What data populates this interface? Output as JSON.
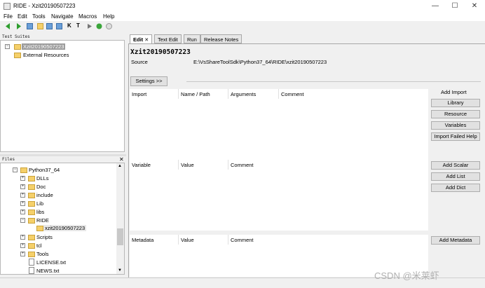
{
  "window": {
    "title": "RIDE - Xzit20190507223",
    "min": "—",
    "max": "☐",
    "close": "✕"
  },
  "menu": [
    "File",
    "Edit",
    "Tools",
    "Navigate",
    "Macros",
    "Help"
  ],
  "toolbar": {
    "icons": [
      "back-icon",
      "forward-icon",
      "open-folder-icon",
      "open-file-icon",
      "save-icon",
      "save-all-icon",
      "search-keyword-icon",
      "search-tests-icon",
      "run-icon",
      "debug-icon",
      "stop-icon"
    ]
  },
  "test_suites": {
    "header": "Test Suites",
    "items": [
      "Xzit20190507223",
      "External Resources"
    ]
  },
  "files": {
    "header": "Files",
    "close": "✕",
    "items": [
      "Python37_64",
      "DLLs",
      "Doc",
      "include",
      "Lib",
      "libs",
      "RIDE",
      "xzit20190507223",
      "Scripts",
      "tcl",
      "Tools",
      "LICENSE.txt",
      "NEWS.txt"
    ]
  },
  "tabs": [
    "Edit",
    "Text Edit",
    "Run",
    "Release Notes"
  ],
  "tab_close": "✕",
  "editor": {
    "suite_name": "Xzit20190507223",
    "source_label": "Source",
    "source_value": "E:\\VsShareToolSdk\\Python37_64\\RIDE\\xzit20190507223",
    "settings_button": "Settings >>",
    "import_table": {
      "headers": [
        "Import",
        "Name / Path",
        "Arguments",
        "Comment"
      ]
    },
    "import_buttons": {
      "title": "Add Import",
      "items": [
        "Library",
        "Resource",
        "Variables",
        "Import Failed Help"
      ]
    },
    "variable_table": {
      "headers": [
        "Variable",
        "Value",
        "Comment"
      ]
    },
    "variable_buttons": [
      "Add Scalar",
      "Add List",
      "Add Dict"
    ],
    "metadata_table": {
      "headers": [
        "Metadata",
        "Value",
        "Comment"
      ]
    },
    "metadata_button": "Add Metadata"
  },
  "watermark": "CSDN @米莱虾",
  "colors": {
    "selection": "#9c9c9c",
    "folder": "#f5d06a",
    "play": "#2e9e2e"
  }
}
